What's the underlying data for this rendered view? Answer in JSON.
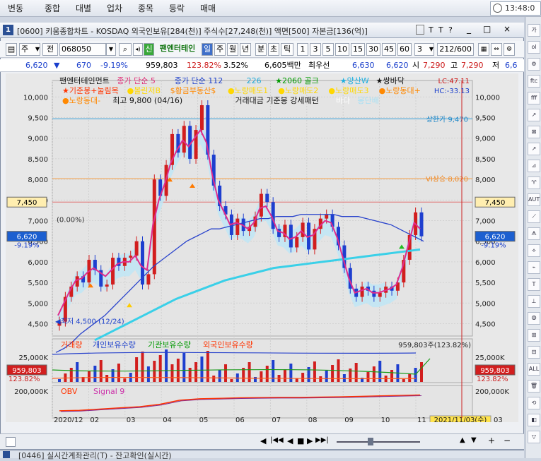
{
  "menu": {
    "items": [
      "변동",
      "종합",
      "대별",
      "업차",
      "종목",
      "등락",
      "매매"
    ],
    "time": "13:48:0"
  },
  "window": {
    "num": "1",
    "title": "[0600] 키움종합차트 - KOSDAQ 외국인보유[284(천)] 주식수[27,248(천)] 액면[500] 자본금[136(억)]",
    "controls": [
      "T",
      "T",
      "?",
      "_",
      "□",
      "×"
    ]
  },
  "toolbar": {
    "type": "주",
    "mode": "전",
    "code": "068050",
    "stock_name": "팬엔터테인",
    "periods": [
      "일",
      "주",
      "월",
      "년",
      "분",
      "초",
      "틱"
    ],
    "minutes": [
      "1",
      "3",
      "5",
      "10",
      "15",
      "30",
      "45",
      "60"
    ],
    "count_select": "3",
    "count": "212/600"
  },
  "quote": {
    "price": "6,620",
    "change": "670",
    "change_pct": "-9.19%",
    "volume": "959,803",
    "vol_ratio": "123.82%",
    "turnover": "3.52%",
    "amount": "6,605백만",
    "best_label": "최우선",
    "ask": "6,630",
    "bid": "6,620",
    "open_label": "시",
    "open": "7,290",
    "high_label": "고",
    "high": "7,290",
    "low_label": "저",
    "low": "6,6"
  },
  "legend": {
    "line1": [
      {
        "t": "팬엔터테인먼트",
        "c": "#111111"
      },
      {
        "t": "종가 단순 5",
        "c": "#e0307a"
      },
      {
        "t": "종가 단순 112",
        "c": "#2244cc"
      },
      {
        "t": "226",
        "c": "#20a8d8"
      },
      {
        "t": "★2060 골크",
        "c": "#009900"
      },
      {
        "t": "★양산W",
        "c": "#20b0e0"
      },
      {
        "t": "★쌍바닥",
        "c": "#111111"
      }
    ],
    "line2": [
      {
        "t": "★기준봉+눌림목",
        "c": "#ff3300"
      },
      {
        "t": "●볼린저B",
        "c": "#ffd700"
      },
      {
        "t": "$황금부동산$",
        "c": "#ff8800"
      },
      {
        "t": "●노랑매도1",
        "c": "#ffd700"
      },
      {
        "t": "●노랑매도2",
        "c": "#ffd700"
      },
      {
        "t": "●노랑매도3",
        "c": "#ffd700"
      },
      {
        "t": "●노랑동대+",
        "c": "#ff8800"
      }
    ],
    "line3": [
      {
        "t": "●노랑동대-",
        "c": "#ff8800"
      },
      {
        "t": "최고 9,800 (04/16)",
        "c": "#111111"
      },
      {
        "t": "거래대금 기준봉 강세패턴",
        "c": "#111111"
      },
      {
        "t": "바다",
        "c": "#ffffff"
      },
      {
        "t": "몽단배",
        "c": "#a6e0f5"
      }
    ],
    "lc": "LC:47.11",
    "hc": "HC:-33.13"
  },
  "chart_data": {
    "type": "line",
    "title": "팬엔터테인먼트",
    "x_labels": [
      "2020/12",
      "02",
      "03",
      "04",
      "05",
      "06",
      "07",
      "08",
      "09",
      "10",
      "11",
      "2021/11/03(수)",
      "03"
    ],
    "ylim": [
      4200,
      10400
    ],
    "y_ticks": [
      "10,000",
      "9,500",
      "9,000",
      "8,500",
      "8,000",
      "7,500",
      "7,000",
      "6,500",
      "6,000",
      "5,500",
      "5,000",
      "4,500"
    ],
    "series": [
      {
        "name": "종가",
        "values": [
          4550,
          5150,
          5400,
          5650,
          5500,
          6050,
          5800,
          5400,
          5450,
          6100,
          5900,
          6100,
          6150,
          6500,
          5450,
          5700,
          8000,
          7600,
          8350,
          9100,
          8650,
          9300,
          8500,
          9200,
          9800,
          8600,
          7850,
          7350,
          7150,
          6650,
          7050,
          6750,
          6850,
          7100,
          7650,
          7450,
          6800,
          6600,
          6900,
          6350,
          6600,
          6950,
          6300,
          6800,
          7050,
          7150,
          6850,
          6400,
          5850,
          5350,
          5150,
          5400,
          5300,
          5150,
          5250,
          5400,
          5300,
          5500,
          6050,
          6650,
          7200,
          6620
        ]
      },
      {
        "name": "종가 단순 5",
        "values": [
          4700,
          5000,
          5300,
          5550,
          5600,
          5750,
          5850,
          5750,
          5650,
          5800,
          5950,
          6000,
          6000,
          6150,
          5900,
          5800,
          6900,
          7500,
          7900,
          8400,
          8700,
          8950,
          8800,
          9000,
          9200,
          8900,
          8100,
          7500,
          7200,
          6900,
          6950,
          6900,
          6800,
          6950,
          7300,
          7350,
          7100,
          6750,
          6700,
          6550,
          6600,
          6750,
          6600,
          6650,
          6850,
          7000,
          6950,
          6600,
          6100,
          5600,
          5250,
          5300,
          5350,
          5250,
          5250,
          5300,
          5350,
          5450,
          5850,
          6400,
          6950,
          6800
        ]
      },
      {
        "name": "종가 단순 112",
        "values": [
          3800,
          3900,
          4050,
          4250,
          4400,
          4550,
          4700,
          4900,
          5100,
          5300,
          5500,
          5700,
          5900,
          6050,
          6200,
          6350,
          6500,
          6600,
          6700,
          6800,
          6800,
          6850,
          6900,
          6950,
          7000,
          7050,
          7050,
          7100,
          7100,
          7100,
          7150,
          7150,
          7150,
          7150,
          7150,
          7100,
          7100,
          7100,
          7050,
          7000,
          6950,
          6900,
          6800,
          6700,
          6600,
          6500
        ]
      },
      {
        "name": "226",
        "values": [
          4100,
          4300,
          4500,
          4700,
          4900,
          5100,
          5250,
          5400,
          5550,
          5650,
          5750,
          5850,
          5900,
          5950,
          6000,
          6050,
          6100,
          6150,
          6200,
          6250,
          6300
        ]
      },
      {
        "name": "OBV",
        "values": [
          0.18,
          0.2,
          0.25,
          0.3,
          0.35,
          0.45,
          0.62,
          0.68,
          0.7,
          0.72,
          0.73,
          0.74,
          0.74,
          0.75,
          0.76,
          0.78,
          0.8,
          0.82,
          0.84
        ]
      }
    ],
    "annotations": {
      "high": "최고 9,800 (04/16)",
      "low": "최저 4,500 (12/24)",
      "upper_limit": "상한가 9,470",
      "vi": "VI상승 8,020",
      "pct": "0.00%",
      "last_price": "7,450",
      "cur_price": "6,620",
      "cur_pct": "-9.19%"
    }
  },
  "volume_panel": {
    "legend": [
      {
        "t": "거래량",
        "c": "#ff3300"
      },
      {
        "t": "개인보유수량",
        "c": "#2244cc"
      },
      {
        "t": "기관보유수량",
        "c": "#009900"
      },
      {
        "t": "외국인보유수량",
        "c": "#ff3300"
      }
    ],
    "value": "959,803주(123.82%)",
    "tick": "25,000K",
    "vol": "959,803",
    "pct": "123.82%"
  },
  "obv_panel": {
    "legend": [
      {
        "t": "OBV",
        "c": "#ff3300"
      },
      {
        "t": "Signal 9",
        "c": "#cc33aa"
      }
    ],
    "tick": "200,000K"
  },
  "nav": {
    "controls": [
      "◀",
      "|◀◀",
      "◀",
      "■",
      "▶",
      "▶▶|"
    ],
    "right": [
      "▲",
      "▼",
      "+",
      "−"
    ]
  },
  "taskbar": {
    "title": "[0446] 실시간계좌관리(T) - 잔고확인(실시간)"
  },
  "right_panel": [
    "가",
    "ol",
    "⚙",
    "ftc",
    "fff",
    "↗",
    "⊠",
    "↗",
    "⊿",
    "♈",
    "AUT",
    "⟋",
    "ᗑ",
    "⟡",
    "⌁",
    "T",
    "⊥",
    "ⵀ",
    "⊞",
    "⊟",
    "ALL",
    "🗑",
    "⟲",
    "◧",
    "▽"
  ]
}
